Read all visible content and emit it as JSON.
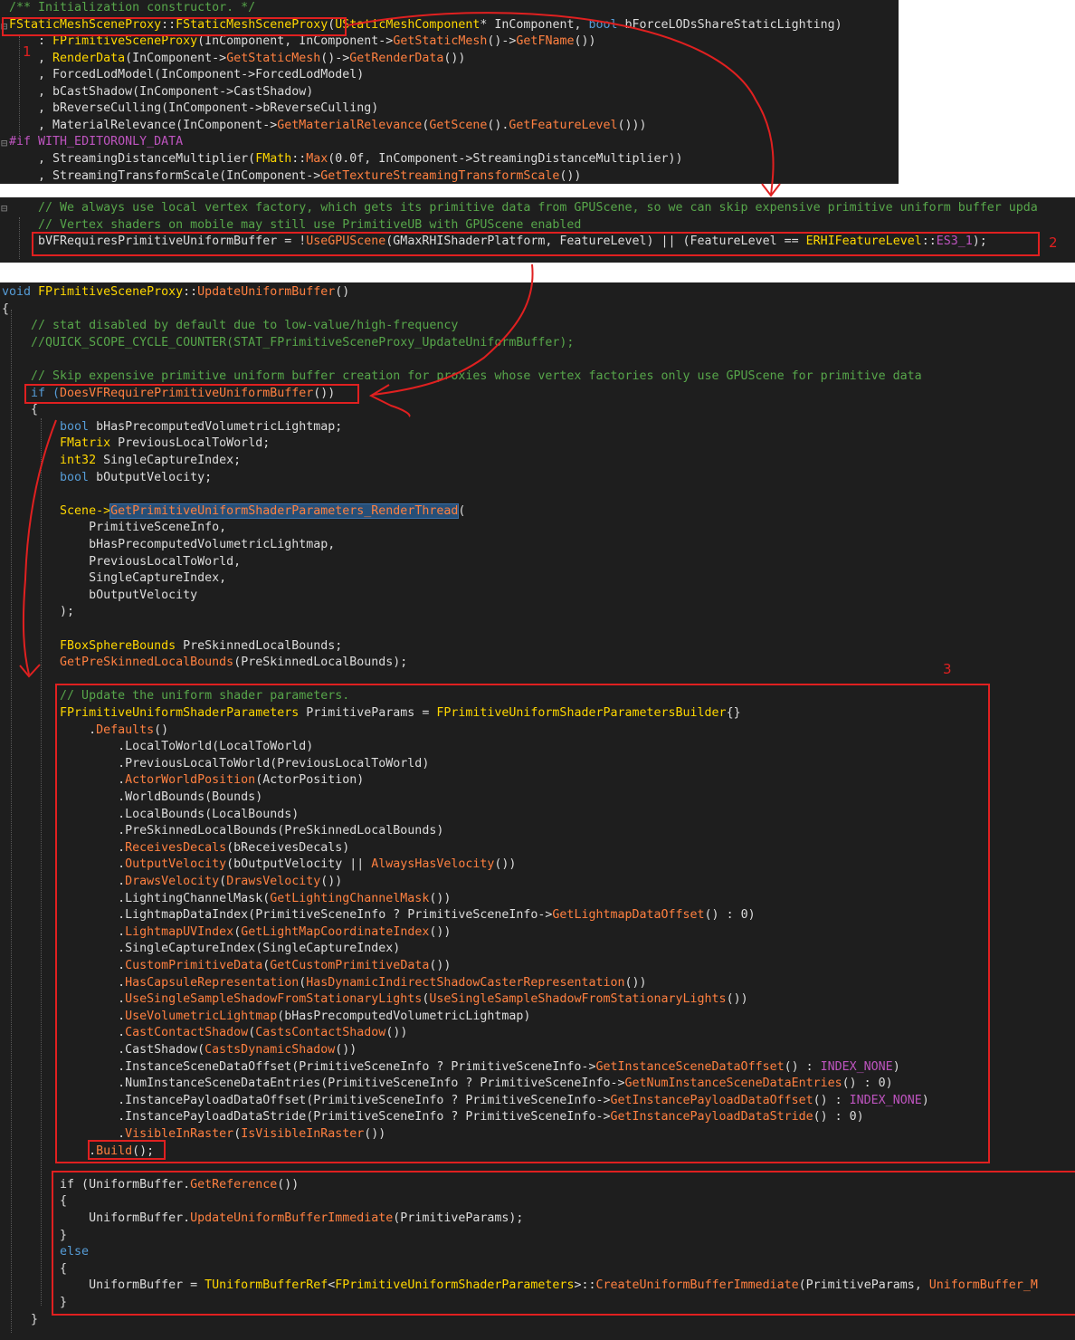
{
  "panel1": {
    "lines": [
      [
        [
          "/** Initialization constructor. */",
          "c-comment"
        ]
      ],
      [
        [
          "FStaticMeshSceneProxy",
          "c-type2"
        ],
        [
          "::",
          "c-var"
        ],
        [
          "FStaticMeshSceneProxy",
          "c-type2"
        ],
        [
          "(",
          "c-var"
        ],
        [
          "UStaticMeshComponent",
          "c-type2"
        ],
        [
          "* InComponent, ",
          "c-var"
        ],
        [
          "bool",
          "c-kw"
        ],
        [
          " bForceLODsShareStaticLighting)",
          "c-var"
        ]
      ],
      [
        [
          "    : ",
          "c-var"
        ],
        [
          "FPrimitiveSceneProxy",
          "c-type2"
        ],
        [
          "(InComponent, InComponent->",
          "c-var"
        ],
        [
          "GetStaticMesh",
          "c-fn2"
        ],
        [
          "()->",
          "c-var"
        ],
        [
          "GetFName",
          "c-fn2"
        ],
        [
          "())",
          "c-var"
        ]
      ],
      [
        [
          "    , ",
          "c-var"
        ],
        [
          "RenderData",
          "c-type2"
        ],
        [
          "(InComponent->",
          "c-var"
        ],
        [
          "GetStaticMesh",
          "c-fn2"
        ],
        [
          "()->",
          "c-var"
        ],
        [
          "GetRenderData",
          "c-fn2"
        ],
        [
          "())",
          "c-var"
        ]
      ],
      [
        [
          "    , ForcedLodModel(InComponent->ForcedLodModel)",
          "c-var"
        ]
      ],
      [
        [
          "    , bCastShadow(InComponent->CastShadow)",
          "c-var"
        ]
      ],
      [
        [
          "    , bReverseCulling(InComponent->bReverseCulling)",
          "c-var"
        ]
      ],
      [
        [
          "    , MaterialRelevance(InComponent->",
          "c-var"
        ],
        [
          "GetMaterialRelevance",
          "c-fn2"
        ],
        [
          "(",
          "c-var"
        ],
        [
          "GetScene",
          "c-fn2"
        ],
        [
          "().",
          "c-var"
        ],
        [
          "GetFeatureLevel",
          "c-fn2"
        ],
        [
          "()))",
          "c-var"
        ]
      ],
      [
        [
          "#if ",
          "c-mac"
        ],
        [
          "WITH_EDITORONLY_DATA",
          "c-mac"
        ]
      ],
      [
        [
          "    , StreamingDistanceMultiplier(",
          "c-var"
        ],
        [
          "FMath",
          "c-type2"
        ],
        [
          "::",
          "c-var"
        ],
        [
          "Max",
          "c-fn2"
        ],
        [
          "(0.0f, InComponent->StreamingDistanceMultiplier))",
          "c-var"
        ]
      ],
      [
        [
          "    , StreamingTransformScale(InComponent->",
          "c-var"
        ],
        [
          "GetTextureStreamingTransformScale",
          "c-fn2"
        ],
        [
          "())",
          "c-var"
        ]
      ]
    ]
  },
  "panel2": {
    "lines": [
      [
        [
          "    // We always use local vertex factory, which gets its primitive data from GPUScene, so we can skip expensive primitive uniform buffer upda",
          "c-comment"
        ]
      ],
      [
        [
          "    // Vertex shaders on mobile may still use PrimitiveUB with GPUScene enabled",
          "c-comment"
        ]
      ],
      [
        [
          "    bVFRequiresPrimitiveUniformBuffer = !",
          "c-var"
        ],
        [
          "UseGPUScene",
          "c-fn2"
        ],
        [
          "(GMaxRHIShaderPlatform, FeatureLevel) || (FeatureLevel == ",
          "c-var"
        ],
        [
          "ERHIFeatureLevel",
          "c-type2"
        ],
        [
          "::",
          "c-var"
        ],
        [
          "ES3_1",
          "c-mac"
        ],
        [
          ");",
          "c-var"
        ]
      ]
    ]
  },
  "panel3": {
    "lines": [
      [
        [
          "void ",
          "c-kw"
        ],
        [
          "FPrimitiveSceneProxy",
          "c-type2"
        ],
        [
          "::",
          "c-var"
        ],
        [
          "UpdateUniformBuffer",
          "c-fn2"
        ],
        [
          "()",
          "c-var"
        ]
      ],
      [
        [
          "{",
          "c-var"
        ]
      ],
      [
        [
          "    // stat disabled by default due to low-value/high-frequency",
          "c-comment"
        ]
      ],
      [
        [
          "    //QUICK_SCOPE_CYCLE_COUNTER(STAT_FPrimitiveSceneProxy_UpdateUniformBuffer);",
          "c-comment"
        ]
      ],
      [
        [
          "",
          "c-var"
        ]
      ],
      [
        [
          "    // Skip expensive primitive uniform buffer creation for proxies whose vertex factories only use GPUScene for primitive data",
          "c-comment"
        ]
      ],
      [
        [
          "    if (",
          "c-kw"
        ],
        [
          "DoesVFRequirePrimitiveUniformBuffer",
          "c-fn2"
        ],
        [
          "())",
          "c-var"
        ]
      ],
      [
        [
          "    {",
          "c-var"
        ]
      ],
      [
        [
          "        bool ",
          "c-kw"
        ],
        [
          "bHasPrecomputedVolumetricLightmap;",
          "c-var"
        ]
      ],
      [
        [
          "        FMatrix ",
          "c-type2"
        ],
        [
          "PreviousLocalToWorld;",
          "c-var"
        ]
      ],
      [
        [
          "        int32 ",
          "c-type2"
        ],
        [
          "SingleCaptureIndex;",
          "c-var"
        ]
      ],
      [
        [
          "        bool ",
          "c-kw"
        ],
        [
          "bOutputVelocity;",
          "c-var"
        ]
      ],
      [
        [
          "",
          "c-var"
        ]
      ],
      [
        [
          "        Scene->",
          "c-type2"
        ],
        [
          "GetPrimitiveUniformShaderParameters_RenderThread",
          "c-fn2"
        ],
        [
          "(",
          "c-var"
        ]
      ],
      [
        [
          "            PrimitiveSceneInfo,",
          "c-var"
        ]
      ],
      [
        [
          "            bHasPrecomputedVolumetricLightmap,",
          "c-var"
        ]
      ],
      [
        [
          "            PreviousLocalToWorld,",
          "c-var"
        ]
      ],
      [
        [
          "            SingleCaptureIndex,",
          "c-var"
        ]
      ],
      [
        [
          "            bOutputVelocity",
          "c-var"
        ]
      ],
      [
        [
          "        );",
          "c-var"
        ]
      ],
      [
        [
          "",
          "c-var"
        ]
      ],
      [
        [
          "        FBoxSphereBounds ",
          "c-type2"
        ],
        [
          "PreSkinnedLocalBounds;",
          "c-var"
        ]
      ],
      [
        [
          "        GetPreSkinnedLocalBounds",
          "c-fn2"
        ],
        [
          "(PreSkinnedLocalBounds);",
          "c-var"
        ]
      ],
      [
        [
          "",
          "c-var"
        ]
      ],
      [
        [
          "        // Update the uniform shader parameters.",
          "c-comment"
        ]
      ],
      [
        [
          "        FPrimitiveUniformShaderParameters ",
          "c-type2"
        ],
        [
          "PrimitiveParams = ",
          "c-var"
        ],
        [
          "FPrimitiveUniformShaderParametersBuilder",
          "c-type2"
        ],
        [
          "{}",
          "c-var"
        ]
      ],
      [
        [
          "            .",
          "c-var"
        ],
        [
          "Defaults",
          "c-fn2"
        ],
        [
          "()",
          "c-var"
        ]
      ],
      [
        [
          "                .LocalToWorld(LocalToWorld)",
          "c-var"
        ]
      ],
      [
        [
          "                .PreviousLocalToWorld(PreviousLocalToWorld)",
          "c-var"
        ]
      ],
      [
        [
          "                .",
          "c-var"
        ],
        [
          "ActorWorldPosition",
          "c-fn2"
        ],
        [
          "(ActorPosition)",
          "c-var"
        ]
      ],
      [
        [
          "                .WorldBounds(Bounds)",
          "c-var"
        ]
      ],
      [
        [
          "                .LocalBounds(LocalBounds)",
          "c-var"
        ]
      ],
      [
        [
          "                .PreSkinnedLocalBounds(PreSkinnedLocalBounds)",
          "c-var"
        ]
      ],
      [
        [
          "                .",
          "c-var"
        ],
        [
          "ReceivesDecals",
          "c-fn2"
        ],
        [
          "(bReceivesDecals)",
          "c-var"
        ]
      ],
      [
        [
          "                .",
          "c-var"
        ],
        [
          "OutputVelocity",
          "c-fn2"
        ],
        [
          "(bOutputVelocity || ",
          "c-var"
        ],
        [
          "AlwaysHasVelocity",
          "c-fn2"
        ],
        [
          "())",
          "c-var"
        ]
      ],
      [
        [
          "                .",
          "c-var"
        ],
        [
          "DrawsVelocity",
          "c-fn2"
        ],
        [
          "(",
          "c-var"
        ],
        [
          "DrawsVelocity",
          "c-fn2"
        ],
        [
          "())",
          "c-var"
        ]
      ],
      [
        [
          "                .LightingChannelMask(",
          "c-var"
        ],
        [
          "GetLightingChannelMask",
          "c-fn2"
        ],
        [
          "())",
          "c-var"
        ]
      ],
      [
        [
          "                .LightmapDataIndex(PrimitiveSceneInfo ? PrimitiveSceneInfo->",
          "c-var"
        ],
        [
          "GetLightmapDataOffset",
          "c-fn2"
        ],
        [
          "() : 0)",
          "c-var"
        ]
      ],
      [
        [
          "                .",
          "c-var"
        ],
        [
          "LightmapUVIndex",
          "c-fn2"
        ],
        [
          "(",
          "c-var"
        ],
        [
          "GetLightMapCoordinateIndex",
          "c-fn2"
        ],
        [
          "())",
          "c-var"
        ]
      ],
      [
        [
          "                .SingleCaptureIndex(SingleCaptureIndex)",
          "c-var"
        ]
      ],
      [
        [
          "                .",
          "c-var"
        ],
        [
          "CustomPrimitiveData",
          "c-fn2"
        ],
        [
          "(",
          "c-var"
        ],
        [
          "GetCustomPrimitiveData",
          "c-fn2"
        ],
        [
          "())",
          "c-var"
        ]
      ],
      [
        [
          "                .",
          "c-var"
        ],
        [
          "HasCapsuleRepresentation",
          "c-fn2"
        ],
        [
          "(",
          "c-var"
        ],
        [
          "HasDynamicIndirectShadowCasterRepresentation",
          "c-fn2"
        ],
        [
          "())",
          "c-var"
        ]
      ],
      [
        [
          "                .",
          "c-var"
        ],
        [
          "UseSingleSampleShadowFromStationaryLights",
          "c-fn2"
        ],
        [
          "(",
          "c-var"
        ],
        [
          "UseSingleSampleShadowFromStationaryLights",
          "c-fn2"
        ],
        [
          "())",
          "c-var"
        ]
      ],
      [
        [
          "                .",
          "c-var"
        ],
        [
          "UseVolumetricLightmap",
          "c-fn2"
        ],
        [
          "(bHasPrecomputedVolumetricLightmap)",
          "c-var"
        ]
      ],
      [
        [
          "                .",
          "c-var"
        ],
        [
          "CastContactShadow",
          "c-fn2"
        ],
        [
          "(",
          "c-var"
        ],
        [
          "CastsContactShadow",
          "c-fn2"
        ],
        [
          "())",
          "c-var"
        ]
      ],
      [
        [
          "                .CastShadow(",
          "c-var"
        ],
        [
          "CastsDynamicShadow",
          "c-fn2"
        ],
        [
          "())",
          "c-var"
        ]
      ],
      [
        [
          "                .InstanceSceneDataOffset(PrimitiveSceneInfo ? PrimitiveSceneInfo->",
          "c-var"
        ],
        [
          "GetInstanceSceneDataOffset",
          "c-fn2"
        ],
        [
          "() : ",
          "c-var"
        ],
        [
          "INDEX_NONE",
          "c-mac"
        ],
        [
          ")",
          "c-var"
        ]
      ],
      [
        [
          "                .NumInstanceSceneDataEntries(PrimitiveSceneInfo ? PrimitiveSceneInfo->",
          "c-var"
        ],
        [
          "GetNumInstanceSceneDataEntries",
          "c-fn2"
        ],
        [
          "() : 0)",
          "c-var"
        ]
      ],
      [
        [
          "                .InstancePayloadDataOffset(PrimitiveSceneInfo ? PrimitiveSceneInfo->",
          "c-var"
        ],
        [
          "GetInstancePayloadDataOffset",
          "c-fn2"
        ],
        [
          "() : ",
          "c-var"
        ],
        [
          "INDEX_NONE",
          "c-mac"
        ],
        [
          ")",
          "c-var"
        ]
      ],
      [
        [
          "                .InstancePayloadDataStride(PrimitiveSceneInfo ? PrimitiveSceneInfo->",
          "c-var"
        ],
        [
          "GetInstancePayloadDataStride",
          "c-fn2"
        ],
        [
          "() : 0)",
          "c-var"
        ]
      ],
      [
        [
          "                .",
          "c-var"
        ],
        [
          "VisibleInRaster",
          "c-fn2"
        ],
        [
          "(",
          "c-var"
        ],
        [
          "IsVisibleInRaster",
          "c-fn2"
        ],
        [
          "())",
          "c-var"
        ]
      ],
      [
        [
          "            .",
          "c-var"
        ],
        [
          "Build",
          "c-fn2"
        ],
        [
          "();",
          "c-var"
        ]
      ],
      [
        [
          "",
          "c-var"
        ]
      ],
      [
        [
          "        if (UniformBuffer.",
          "c-var"
        ],
        [
          "GetReference",
          "c-fn2"
        ],
        [
          "())",
          "c-var"
        ]
      ],
      [
        [
          "        {",
          "c-var"
        ]
      ],
      [
        [
          "            UniformBuffer.",
          "c-var"
        ],
        [
          "UpdateUniformBufferImmediate",
          "c-fn2"
        ],
        [
          "(PrimitiveParams);",
          "c-var"
        ]
      ],
      [
        [
          "        }",
          "c-var"
        ]
      ],
      [
        [
          "        else",
          "c-kw"
        ]
      ],
      [
        [
          "        {",
          "c-var"
        ]
      ],
      [
        [
          "            UniformBuffer = ",
          "c-var"
        ],
        [
          "TUniformBufferRef",
          "c-type2"
        ],
        [
          "<",
          "c-var"
        ],
        [
          "FPrimitiveUniformShaderParameters",
          "c-type2"
        ],
        [
          ">::",
          "c-var"
        ],
        [
          "CreateUniformBufferImmediate",
          "c-fn2"
        ],
        [
          "(PrimitiveParams, ",
          "c-var"
        ],
        [
          "UniformBuffer_M",
          "c-fn2"
        ]
      ],
      [
        [
          "        }",
          "c-var"
        ]
      ],
      [
        [
          "    }",
          "c-var"
        ]
      ]
    ]
  },
  "annotations": {
    "label1": "1",
    "label2": "2",
    "label3": "3"
  },
  "colors": {
    "annotation": "#e02020",
    "editor_bg": "#1e1e1e"
  }
}
